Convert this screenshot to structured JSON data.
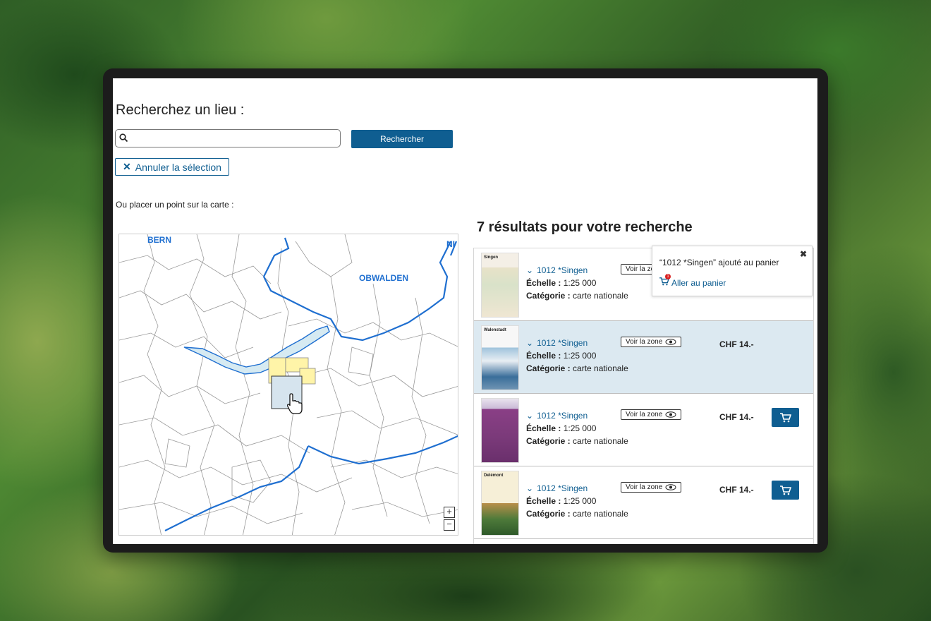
{
  "search": {
    "title": "Recherchez un lieu :",
    "value": "",
    "placeholder": "",
    "button_label": "Rechercher",
    "cancel_label": "Annuler la sélection",
    "map_hint": "Ou placer un point sur la carte :"
  },
  "map": {
    "labels": [
      "BERN",
      "OBWALDEN",
      "NI"
    ],
    "zoom_in": "+",
    "zoom_out": "−"
  },
  "results": {
    "title": "7 résultats pour votre recherche",
    "items": [
      {
        "thumb_title": "Singen",
        "name": "1012 *Singen",
        "scale_label": "Échelle :",
        "scale": "1:25 000",
        "category_label": "Catégorie :",
        "category": "carte nationale",
        "zone_label": "Voir la zone",
        "price": "",
        "selected": false
      },
      {
        "thumb_title": "Walenstadt",
        "name": "1012 *Singen",
        "scale_label": "Échelle :",
        "scale": "1:25 000",
        "category_label": "Catégorie :",
        "category": "carte nationale",
        "zone_label": "Voir la zone",
        "price": "CHF 14.-",
        "selected": true
      },
      {
        "thumb_title": "",
        "name": "1012 *Singen",
        "scale_label": "Échelle :",
        "scale": "1:25 000",
        "category_label": "Catégorie :",
        "category": "carte nationale",
        "zone_label": "Voir la zone",
        "price": "CHF 14.-",
        "selected": false
      },
      {
        "thumb_title": "Delémont",
        "name": "1012 *Singen",
        "scale_label": "Échelle :",
        "scale": "1:25 000",
        "category_label": "Catégorie :",
        "category": "carte nationale",
        "zone_label": "Voir la zone",
        "price": "CHF 14.-",
        "selected": false
      }
    ]
  },
  "popup": {
    "message": "“1012 *Singen” ajouté au panier",
    "link_label": "Aller au panier",
    "cart_count": "1",
    "close": "✖"
  },
  "colors": {
    "accent": "#0f5e91",
    "selected_row": "#dce9f1",
    "lake": "#d6eaf2",
    "canton_border": "#1f6fd0",
    "tile": "#fff4a8"
  }
}
